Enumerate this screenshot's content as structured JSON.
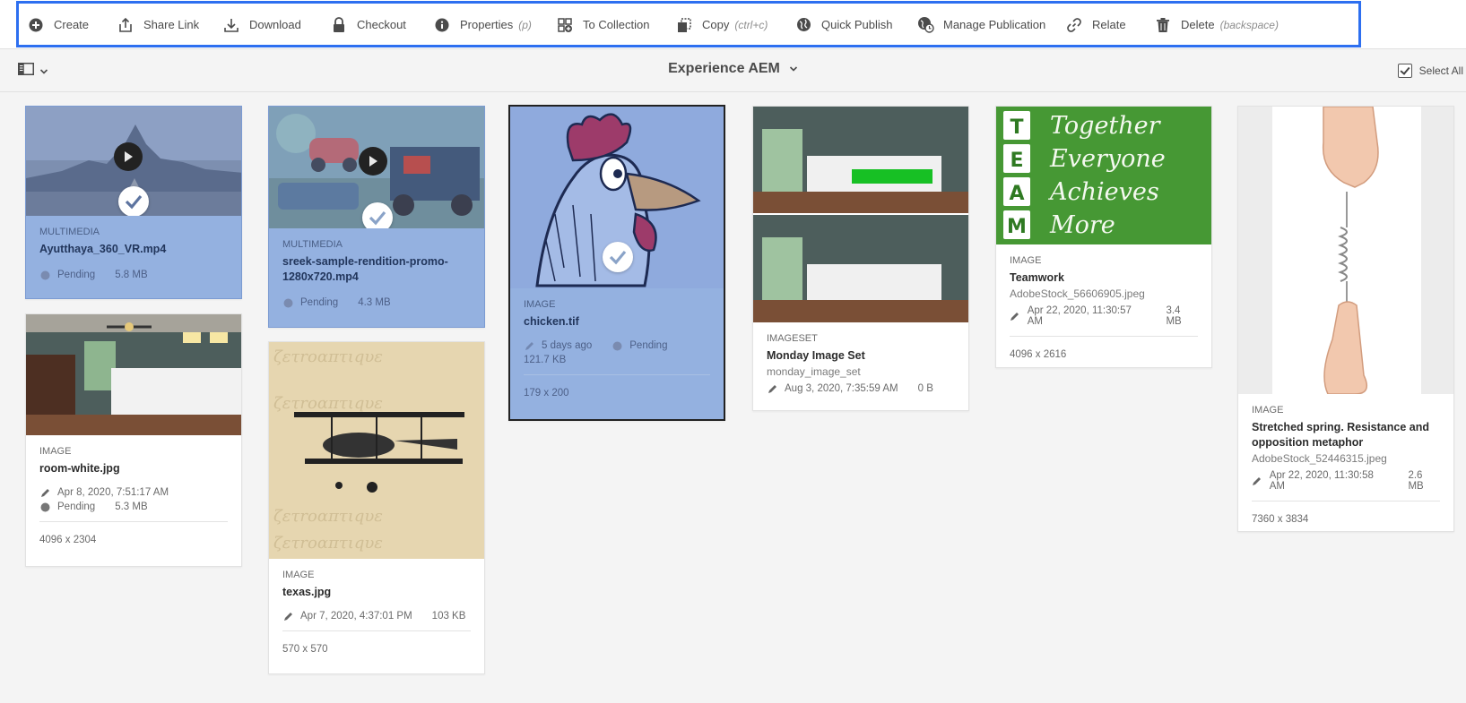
{
  "actions": {
    "create": "Create",
    "share_link": "Share Link",
    "download": "Download",
    "checkout": "Checkout",
    "properties": "Properties",
    "properties_hint": "(p)",
    "to_collection": "To Collection",
    "copy": "Copy",
    "copy_hint": "(ctrl+c)",
    "quick_publish": "Quick Publish",
    "manage_publication": "Manage Publication",
    "relate": "Relate",
    "delete": "Delete",
    "delete_hint": "(backspace)"
  },
  "header": {
    "title": "Experience AEM",
    "select_all": "Select All"
  },
  "colors": {
    "selection_frame": "#2d6ff0",
    "selected_card": "#94b1e0"
  },
  "cards": {
    "ayutthaya": {
      "kind": "MULTIMEDIA",
      "name": "Ayutthaya_360_VR.mp4",
      "status": "Pending",
      "size": "5.8 MB",
      "selected": true
    },
    "sreek": {
      "kind": "MULTIMEDIA",
      "name": "sreek-sample-rendition-promo-1280x720.mp4",
      "status": "Pending",
      "size": "4.3 MB",
      "selected": true
    },
    "chicken": {
      "kind": "IMAGE",
      "name": "chicken.tif",
      "modified": "5 days ago",
      "status": "Pending",
      "size": "121.7 KB",
      "dims": "179 x 200",
      "selected": true
    },
    "monday": {
      "kind": "IMAGESET",
      "name": "Monday Image Set",
      "sub": "monday_image_set",
      "modified": "Aug 3, 2020, 7:35:59 AM",
      "size": "0 B"
    },
    "teamwork": {
      "kind": "IMAGE",
      "name": "Teamwork",
      "sub": "AdobeStock_56606905.jpeg",
      "modified": "Apr 22, 2020, 11:30:57 AM",
      "size": "3.4 MB",
      "dims": "4096 x 2616",
      "thumb_text": [
        "Together",
        "Everyone",
        "Achieves",
        "More"
      ],
      "thumb_letters": [
        "T",
        "E",
        "A",
        "M"
      ]
    },
    "spring": {
      "kind": "IMAGE",
      "name": "Stretched spring. Resistance and opposition metaphor",
      "sub": "AdobeStock_52446315.jpeg",
      "modified": "Apr 22, 2020, 11:30:58 AM",
      "size": "2.6 MB",
      "dims": "7360 x 3834"
    },
    "room": {
      "kind": "IMAGE",
      "name": "room-white.jpg",
      "modified": "Apr 8, 2020, 7:51:17 AM",
      "status": "Pending",
      "size": "5.3 MB",
      "dims": "4096 x 2304"
    },
    "texas": {
      "kind": "IMAGE",
      "name": "texas.jpg",
      "modified": "Apr 7, 2020, 4:37:01 PM",
      "size": "103 KB",
      "dims": "570 x 570"
    }
  }
}
